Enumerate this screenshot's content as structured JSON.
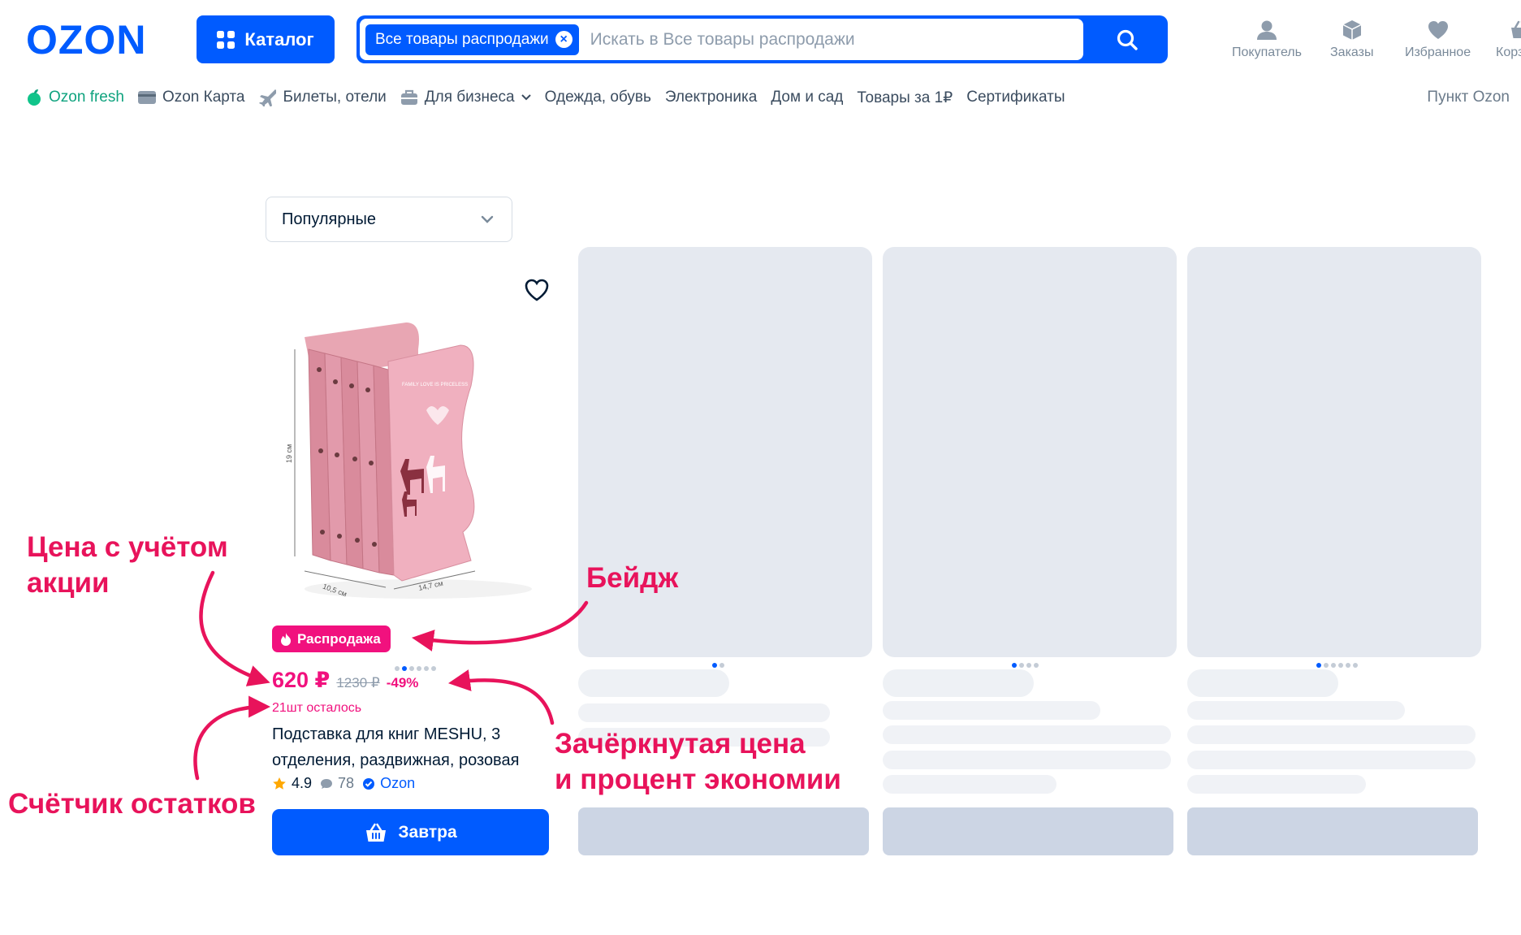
{
  "header": {
    "logo_text": "OZON",
    "catalog_label": "Каталог",
    "search": {
      "chip_label": "Все товары распродажи",
      "placeholder": "Искать в Все товары распродажи"
    },
    "actions": [
      {
        "label": "Покупатель",
        "icon": "user-icon"
      },
      {
        "label": "Заказы",
        "icon": "box-icon"
      },
      {
        "label": "Избранное",
        "icon": "heart-icon"
      },
      {
        "label": "Корзина",
        "icon": "cart-icon"
      }
    ]
  },
  "nav": {
    "items": [
      "Ozon fresh",
      "Ozon Карта",
      "Билеты, отели",
      "Для бизнеса",
      "Одежда, обувь",
      "Электроника",
      "Дом и сад",
      "Товары за 1₽",
      "Сертификаты"
    ],
    "right_label": "Пункт Ozon"
  },
  "sort": {
    "selected": "Популярные"
  },
  "product": {
    "badge": "Распродажа",
    "price": "620 ₽",
    "old_price": "1230 ₽",
    "discount": "-49%",
    "stock": "21шт осталось",
    "title": "Подставка для книг MESHU, 3 отделения, раздвижная, розовая",
    "rating": "4.9",
    "reviews": "78",
    "seller": "Ozon",
    "buy_label": "Завтра",
    "image_text": {
      "height": "19 см",
      "depth": "10,5 см",
      "width": "14,7 см",
      "print": "FAMILY LOVE IS PRICELESS"
    }
  },
  "annotations": {
    "promo_price": [
      "Цена с учётом",
      "акции"
    ],
    "badge": "Бейдж",
    "strike": [
      "Зачёркнутая цена",
      "и процент экономии"
    ],
    "stock": "Счётчик остатков"
  },
  "colors": {
    "brand": "#005bff",
    "sale": "#f1117e",
    "annotation": "#e8135b",
    "skeleton": "#e5e9f0"
  }
}
